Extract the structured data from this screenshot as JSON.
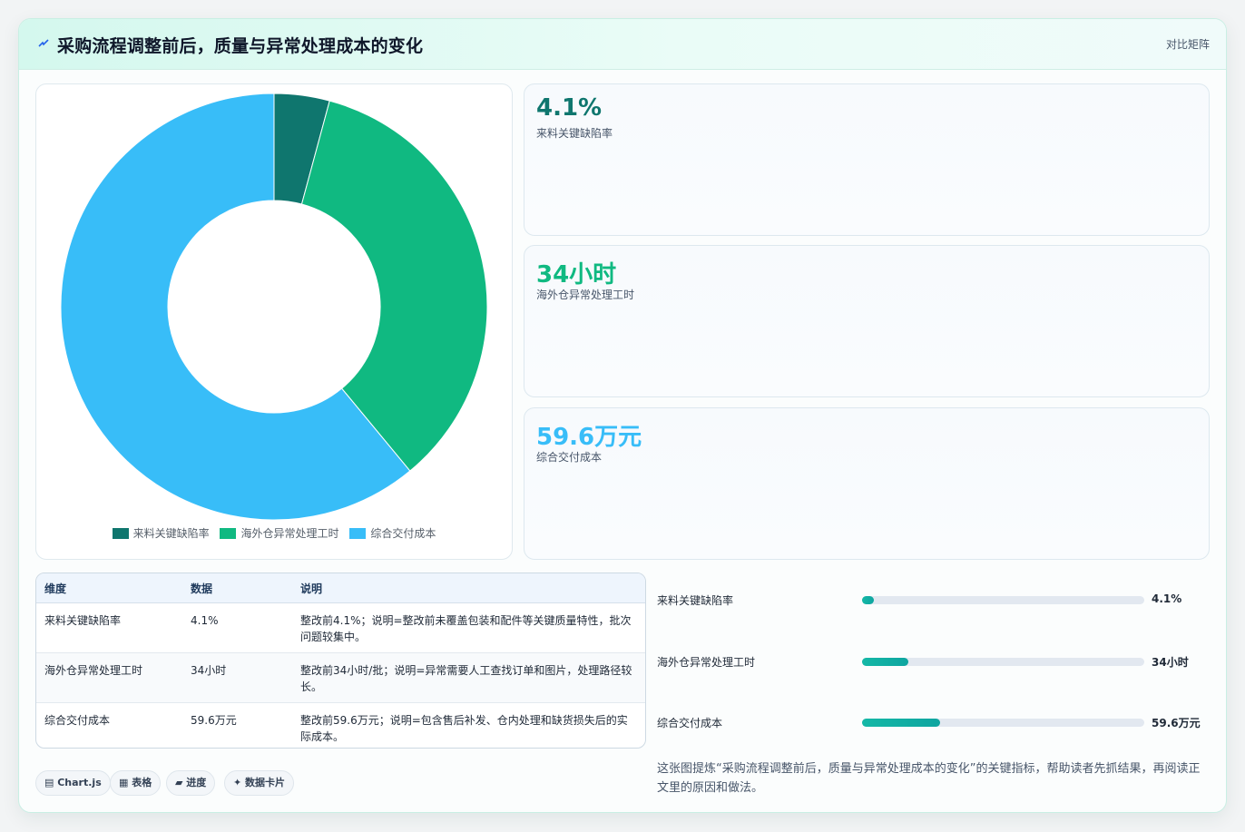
{
  "header": {
    "title": "采购流程调整前后，质量与异常处理成本的变化",
    "badge": "对比矩阵"
  },
  "chart_data": {
    "type": "doughnut",
    "categories": [
      "来料关键缺陷率",
      "海外仓异常处理工时",
      "综合交付成本"
    ],
    "values": [
      4.1,
      34,
      59.6
    ],
    "colors": [
      "#0f766e",
      "#10b981",
      "#38bdf8"
    ],
    "legend_position": "bottom"
  },
  "kpis": [
    {
      "value": "4.1%",
      "label": "来料关键缺陷率",
      "color": "#0f766e"
    },
    {
      "value": "34小时",
      "label": "海外仓异常处理工时",
      "color": "#10b981"
    },
    {
      "value": "59.6万元",
      "label": "综合交付成本",
      "color": "#38bdf8"
    }
  ],
  "table": {
    "headers": [
      "维度",
      "数据",
      "说明"
    ],
    "rows": [
      [
        "来料关键缺陷率",
        "4.1%",
        "整改前4.1%；说明=整改前未覆盖包装和配件等关键质量特性，批次问题较集中。"
      ],
      [
        "海外仓异常处理工时",
        "34小时",
        "整改前34小时/批；说明=异常需要人工查找订单和图片，处理路径较长。"
      ],
      [
        "综合交付成本",
        "59.6万元",
        "整改前59.6万元；说明=包含售后补发、仓内处理和缺货损失后的实际成本。"
      ]
    ]
  },
  "progress": [
    {
      "label": "来料关键缺陷率",
      "value": "4.1%",
      "fraction": 0.041
    },
    {
      "label": "海外仓异常处理工时",
      "value": "34小时",
      "fraction": 0.163
    },
    {
      "label": "综合交付成本",
      "value": "59.6万元",
      "fraction": 0.277
    }
  ],
  "tags": [
    "Chart.js",
    "表格",
    "进度",
    "数据卡片"
  ],
  "note": "这张图提炼“采购流程调整前后，质量与异常处理成本的变化”的关键指标，帮助读者先抓结果，再阅读正文里的原因和做法。"
}
